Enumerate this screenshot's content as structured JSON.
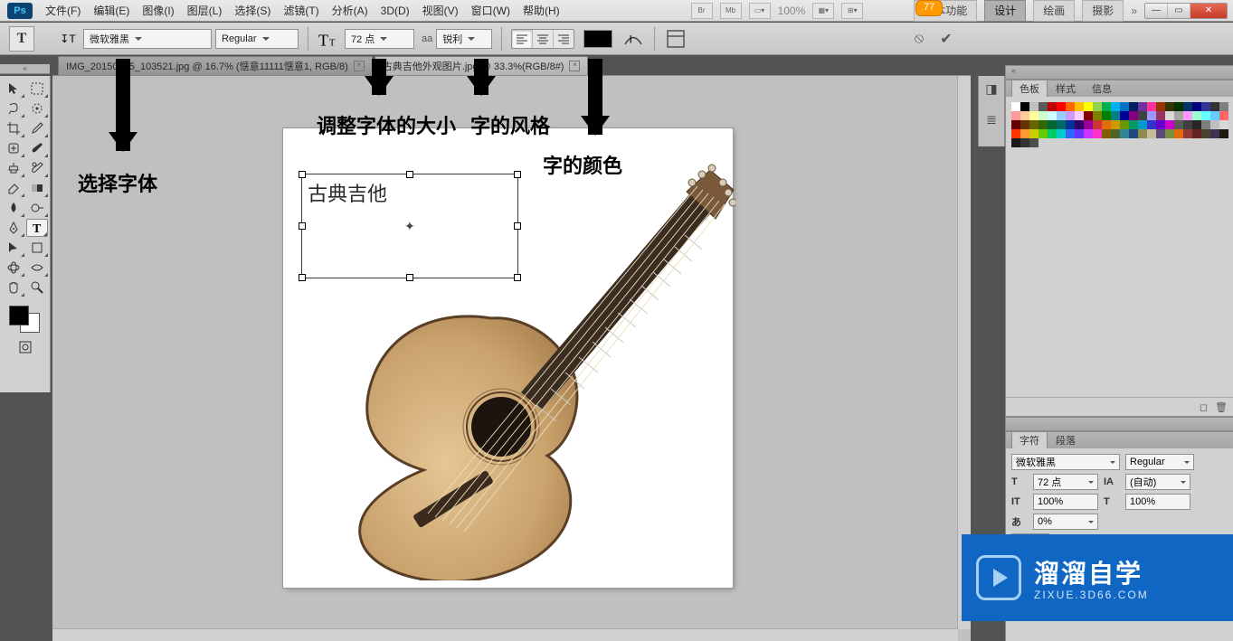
{
  "app": {
    "logo": "Ps"
  },
  "menu": {
    "items": [
      "文件(F)",
      "编辑(E)",
      "图像(I)",
      "图层(L)",
      "选择(S)",
      "滤镜(T)",
      "分析(A)",
      "3D(D)",
      "视图(V)",
      "窗口(W)",
      "帮助(H)"
    ]
  },
  "header_right": {
    "zoom": "100%",
    "notif": "77",
    "workspaces": [
      "基本功能",
      "设计",
      "绘画",
      "摄影"
    ],
    "active_workspace_index": 1
  },
  "options": {
    "tool_letter": "T",
    "orientation_icon": "orientation-icon",
    "font_family": "微软雅黑",
    "font_style": "Regular",
    "font_size": "72 点",
    "aa_prefix": "aa",
    "aa_value": "锐利",
    "color": "#000000"
  },
  "doc_tabs": [
    {
      "label": "IMG_20150125_103521.jpg @ 16.7% (惬意11111惬意1, RGB/8)",
      "active": false
    },
    {
      "label": "古典吉他外观图片.jpg @ 33.3%(RGB/8#)",
      "active": true
    }
  ],
  "canvas": {
    "typed_text": "古典吉他"
  },
  "annotations": {
    "font": "选择字体",
    "size": "调整字体的大小",
    "style": "字的风格",
    "color": "字的颜色"
  },
  "panels": {
    "swatches": {
      "tabs": [
        "色板",
        "样式",
        "信息"
      ],
      "active_index": 0
    },
    "character": {
      "tabs": [
        "字符",
        "段落"
      ],
      "active_index": 0,
      "font_family": "微软雅黑",
      "font_style": "Regular",
      "font_size": "72 点",
      "leading": "(自动)",
      "tracking_v": "100%",
      "tracking_h": "100%",
      "baseline": "0%",
      "charcolor": "#000000"
    }
  },
  "swatch_colors": [
    "#ffffff",
    "#000000",
    "#c0c0c0",
    "#595959",
    "#c00000",
    "#ff0000",
    "#ff6600",
    "#ffc000",
    "#ffff00",
    "#92d050",
    "#00b050",
    "#00b0f0",
    "#0070c0",
    "#002060",
    "#7030a0",
    "#ff3399",
    "#993300",
    "#333300",
    "#003300",
    "#003366",
    "#000080",
    "#333399",
    "#333333",
    "#808080",
    "#ff9999",
    "#ffcc99",
    "#ffff99",
    "#ccffcc",
    "#ccffff",
    "#99ccff",
    "#cc99ff",
    "#ffccff",
    "#800000",
    "#808000",
    "#008000",
    "#008080",
    "#000099",
    "#800080",
    "#404040",
    "#9999ff",
    "#993366",
    "#d9d9d9",
    "#a6a6a6",
    "#ff99ff",
    "#99ffcc",
    "#66ffff",
    "#66ccff",
    "#ff6666",
    "#660000",
    "#663300",
    "#666600",
    "#336600",
    "#006633",
    "#006666",
    "#003399",
    "#330066",
    "#990099",
    "#cc3333",
    "#e26b0a",
    "#cc9900",
    "#669900",
    "#009966",
    "#0099cc",
    "#3333cc",
    "#6600cc",
    "#cc00cc",
    "#595959",
    "#3f3f3f",
    "#262626",
    "#7f7f7f",
    "#bfbfbf",
    "#d8d8d8",
    "#ff3300",
    "#ff9933",
    "#cccc00",
    "#66cc00",
    "#00cc66",
    "#00cccc",
    "#3366ff",
    "#6633ff",
    "#cc33ff",
    "#ff33cc",
    "#7f6000",
    "#4f6228",
    "#31859b",
    "#1f497d",
    "#938953",
    "#c4bd97",
    "#5f497a",
    "#76923c",
    "#e36c09",
    "#953734",
    "#632423",
    "#4a452a",
    "#3f3151",
    "#1d1b10",
    "#1a1a1a",
    "#333333",
    "#4d4d4d"
  ],
  "watermark": {
    "title": "溜溜自学",
    "sub": "ZIXUE.3D66.COM"
  }
}
